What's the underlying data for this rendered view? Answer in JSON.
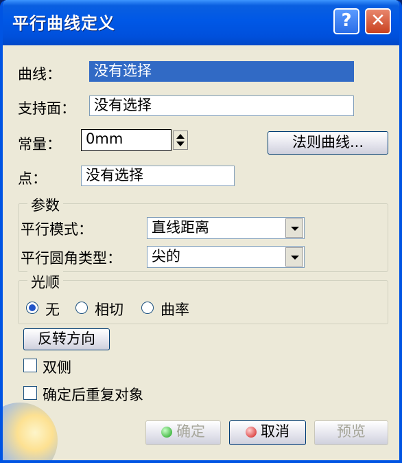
{
  "window": {
    "title": "平行曲线定义",
    "help_label": "?",
    "close_label": "✕"
  },
  "fields": {
    "curve_label": "曲线：",
    "curve_value": "没有选择",
    "support_label": "支持面：",
    "support_value": "没有选择",
    "constant_label": "常量：",
    "constant_value": "0mm",
    "law_button": "法则曲线...",
    "point_label": "点：",
    "point_value": "没有选择"
  },
  "params": {
    "legend": "参数",
    "mode_label": "平行模式：",
    "mode_value": "直线距离",
    "corner_label": "平行圆角类型：",
    "corner_value": "尖的"
  },
  "smooth": {
    "legend": "光顺",
    "options": [
      {
        "label": "无",
        "selected": true
      },
      {
        "label": "相切",
        "selected": false
      },
      {
        "label": "曲率",
        "selected": false
      }
    ]
  },
  "reverse_button": "反转方向",
  "checks": {
    "both_sides": "双侧",
    "repeat": "确定后重复对象"
  },
  "footer": {
    "ok": "确定",
    "cancel": "取消",
    "preview": "预览"
  }
}
